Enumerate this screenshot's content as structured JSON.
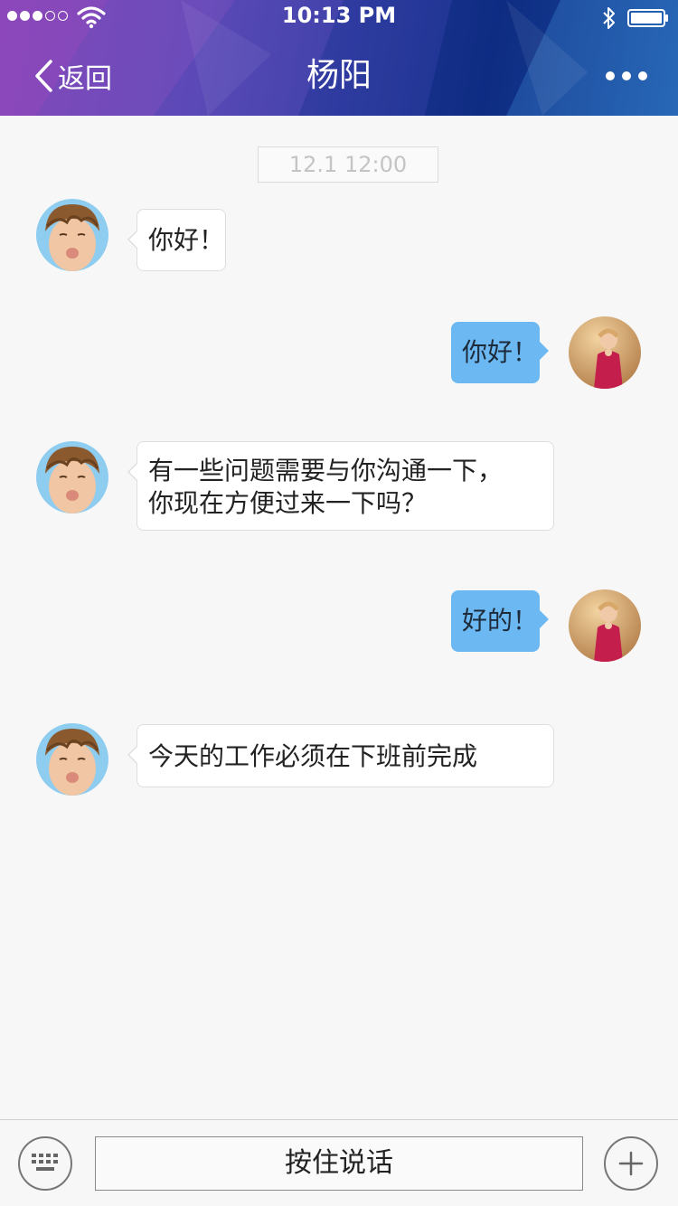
{
  "status_bar": {
    "time": "10:13 PM",
    "signal_bars_filled": 3,
    "signal_bars_total": 5
  },
  "nav": {
    "back_label": "返回",
    "title": "杨阳"
  },
  "chat": {
    "timestamp": "12.1 12:00",
    "messages": [
      {
        "side": "incoming",
        "lines": [
          "你好！"
        ]
      },
      {
        "side": "outgoing",
        "lines": [
          "你好！"
        ]
      },
      {
        "side": "incoming",
        "lines": [
          "有一些问题需要与你沟通一下，",
          "你现在方便过来一下吗？"
        ]
      },
      {
        "side": "outgoing",
        "lines": [
          "好的！"
        ]
      },
      {
        "side": "incoming",
        "lines": [
          "今天的工作必须在下班前完成"
        ]
      }
    ]
  },
  "bottom_bar": {
    "voice_label": "按住说话"
  },
  "colors": {
    "header_gradient_start": "#7d3fb4",
    "header_gradient_end": "#1f5fb0",
    "outgoing_bubble": "#6cb8f2",
    "incoming_bubble": "#ffffff",
    "background": "#f7f7f7"
  },
  "icons": {
    "wifi": "wifi-icon",
    "bluetooth": "bluetooth-icon",
    "battery": "battery-icon",
    "back": "chevron-left-icon",
    "more": "more-dots-icon",
    "keyboard": "keyboard-icon",
    "add": "plus-icon"
  }
}
